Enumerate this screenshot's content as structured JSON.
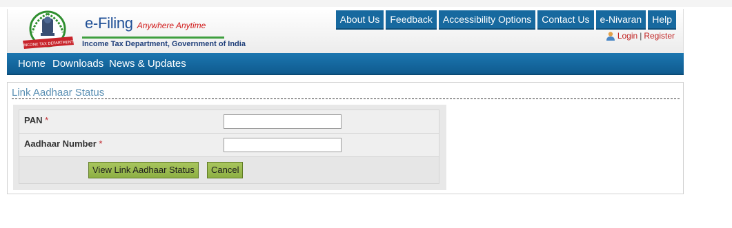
{
  "header": {
    "logo_label": "INCOME TAX DEPARTMENT",
    "brand": "e-Filing",
    "tagline": "Anywhere Anytime",
    "department": "Income Tax Department, Government of India"
  },
  "top_nav": {
    "items": [
      "About Us",
      "Feedback",
      "Accessibility Options",
      "Contact Us",
      "e-Nivaran",
      "Help"
    ]
  },
  "auth": {
    "login": "Login",
    "separator": "|",
    "register": "Register"
  },
  "main_nav": {
    "items": [
      "Home",
      "Downloads",
      "News & Updates"
    ]
  },
  "panel": {
    "title": "Link Aadhaar Status"
  },
  "form": {
    "pan_label": "PAN",
    "pan_value": "",
    "aadhaar_label": "Aadhaar Number",
    "aadhaar_value": "",
    "required_mark": "*",
    "submit_label": "View Link Aadhaar Status",
    "cancel_label": "Cancel"
  },
  "colors": {
    "nav_blue": "#17699f",
    "button_green": "#9dbd51",
    "required_red": "#c0272d"
  }
}
